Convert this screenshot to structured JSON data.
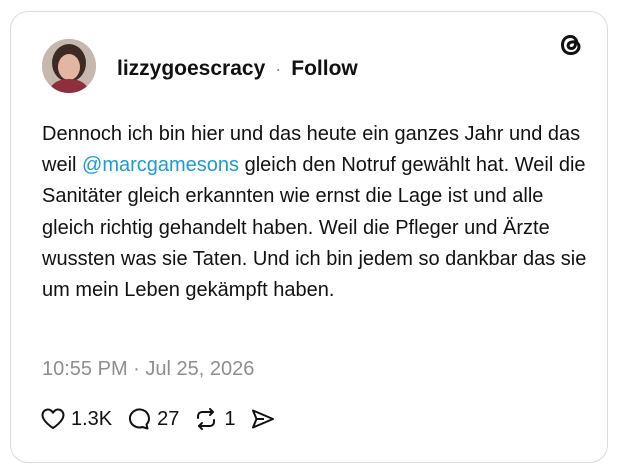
{
  "post": {
    "username": "lizzygoescracy",
    "separator": "·",
    "follow_label": "Follow",
    "text_part1": "Dennoch ich bin hier und das heute ein ganzes Jahr und das weil ",
    "mention": "@marcgamesons",
    "text_part2": " gleich den Notruf gewählt hat. Weil die Sanitäter gleich erkannten wie ernst die Lage ist und alle gleich richtig gehandelt haben. Weil die Pfleger und Ärzte wussten was sie Taten. Und ich bin jedem so dankbar das sie um mein Leben gekämpft haben.",
    "timestamp": "10:55 PM · Jul 25, 2026",
    "platform_icon": "threads-logo-icon"
  },
  "actions": {
    "likes": "1.3K",
    "replies": "27",
    "reposts": "1",
    "like_icon": "heart-icon",
    "reply_icon": "reply-bubble-icon",
    "repost_icon": "repost-icon",
    "share_icon": "send-icon"
  },
  "colors": {
    "mention": "#1d9bd1",
    "timestamp": "#8e8e8e",
    "border": "#dcdcdc"
  }
}
